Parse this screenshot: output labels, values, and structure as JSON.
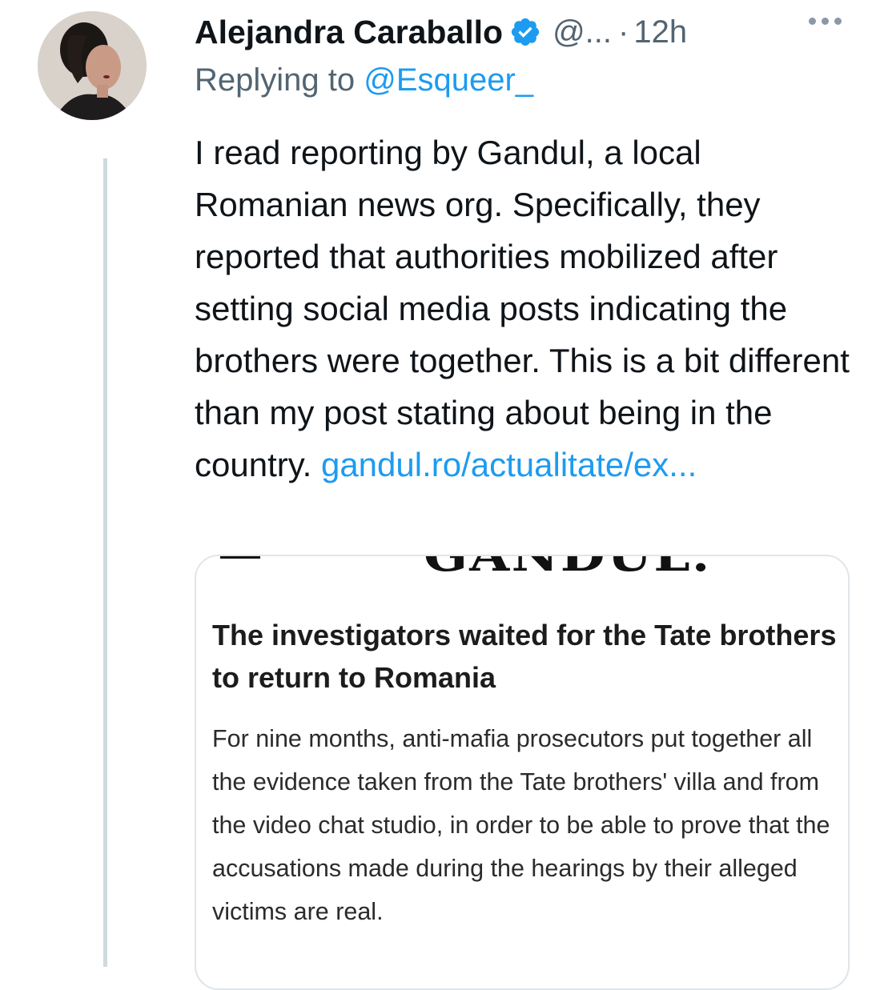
{
  "tweet": {
    "author_name": "Alejandra Caraballo",
    "handle": "@...",
    "separator": "·",
    "time": "12h",
    "replying_prefix": "Replying to",
    "replying_to": "@Esqueer_",
    "text": "I read reporting by Gandul, a local Romanian news org. Specifically, they reported that authorities mobilized after setting social media posts indicating the brothers were together. This is a bit different than my post stating about being in the country.",
    "link_text": "gandul.ro/actualitate/ex..."
  },
  "card": {
    "title": "The investigators waited for the Tate brothers to return to Romania",
    "description": "For nine months, anti-mafia prosecutors put together all the evidence taken from the Tate brothers' villa and from the video chat studio, in order to be able to prove that the accusations made during the hearings by their alleged victims are real."
  },
  "colors": {
    "accent": "#1d9bf0",
    "secondary_text": "#536471",
    "thread_line": "#cfd9de"
  },
  "icons": {
    "verified": "verified-badge-icon",
    "more": "more-options-icon"
  }
}
